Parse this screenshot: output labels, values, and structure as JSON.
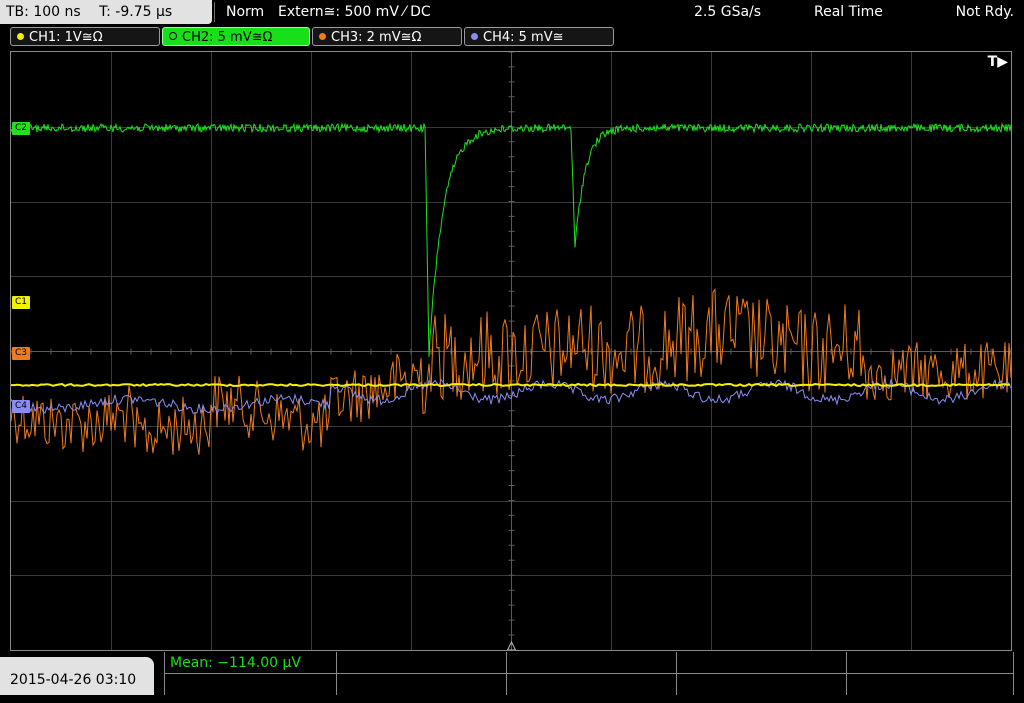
{
  "topbar": {
    "timebase": "TB: 100 ns",
    "trigger_time": "T: -9.75 µs",
    "trigger_mode": "Norm",
    "trigger_source": "Extern≅: 500 mV ⁄ DC",
    "sample_rate": "2.5 GSa/s",
    "acquisition": "Real Time",
    "status": "Not Rdy."
  },
  "channels": [
    {
      "label": "CH1: 1V≅Ω",
      "color": "#f2f200",
      "marker": "C1"
    },
    {
      "label": "CH2: 5 mV≅Ω",
      "color": "#20e020",
      "marker": "C2"
    },
    {
      "label": "CH3: 2 mV≅Ω",
      "color": "#f07b1a",
      "marker": "C3"
    },
    {
      "label": "CH4: 5 mV≅",
      "color": "#8a8cf2",
      "marker": "C4"
    }
  ],
  "trigger_marker": "T▶",
  "measurement": {
    "mean_label": "Mean: −114.00 µV"
  },
  "datetime": "2015-04-26 03:10"
}
